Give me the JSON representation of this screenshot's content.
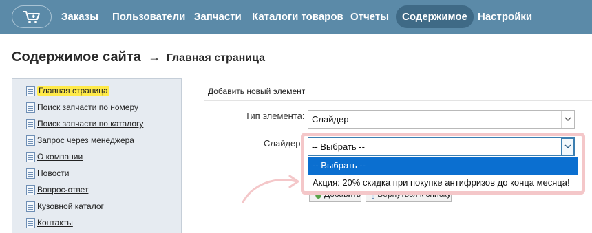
{
  "nav": {
    "items": [
      {
        "label": "Заказы",
        "active": false
      },
      {
        "label": "Пользователи",
        "active": false
      },
      {
        "label": "Запчасти",
        "active": false
      },
      {
        "label": "Каталоги товаров",
        "active": false
      },
      {
        "label": "Отчеты",
        "active": false
      },
      {
        "label": "Содержимое",
        "active": true
      },
      {
        "label": "Настройки",
        "active": false
      }
    ]
  },
  "page": {
    "title": "Содержимое сайта",
    "arrow": "→",
    "subtitle": "Главная страница"
  },
  "tree": {
    "items": [
      {
        "label": "Главная страница",
        "active": true
      },
      {
        "label": "Поиск запчасти по номеру",
        "active": false
      },
      {
        "label": "Поиск запчасти по каталогу",
        "active": false
      },
      {
        "label": "Запрос через менеджера",
        "active": false
      },
      {
        "label": "О компании",
        "active": false
      },
      {
        "label": "Новости",
        "active": false
      },
      {
        "label": "Вопрос-ответ",
        "active": false
      },
      {
        "label": "Кузовной каталог",
        "active": false
      },
      {
        "label": "Контакты",
        "active": false
      }
    ]
  },
  "form": {
    "heading": "Добавить новый элемент",
    "type_label": "Тип элемента:",
    "type_value": "Слайдер",
    "slider_label": "Слайдер:",
    "slider_value": "-- Выбрать --",
    "dropdown_options": [
      {
        "label": "-- Выбрать --",
        "highlighted": true
      },
      {
        "label": "Акция: 20% скидка при покупке антифризов до конца месяца!",
        "highlighted": false
      }
    ],
    "add_button": "Добавить",
    "back_button": "Вернуться к списку"
  },
  "colors": {
    "nav_bg": "#5b8aa8",
    "nav_active": "#3f6a86",
    "tree_bg": "#e6ebf1",
    "active_item": "#ffea48",
    "dropdown_highlight": "#0b6fd0",
    "annotation": "#f4c7c9"
  },
  "icons": {
    "cart": "cart-icon",
    "page": "page-icon",
    "chevron": "chevron-down-icon",
    "annotation_arrow": "curved-arrow-icon"
  }
}
